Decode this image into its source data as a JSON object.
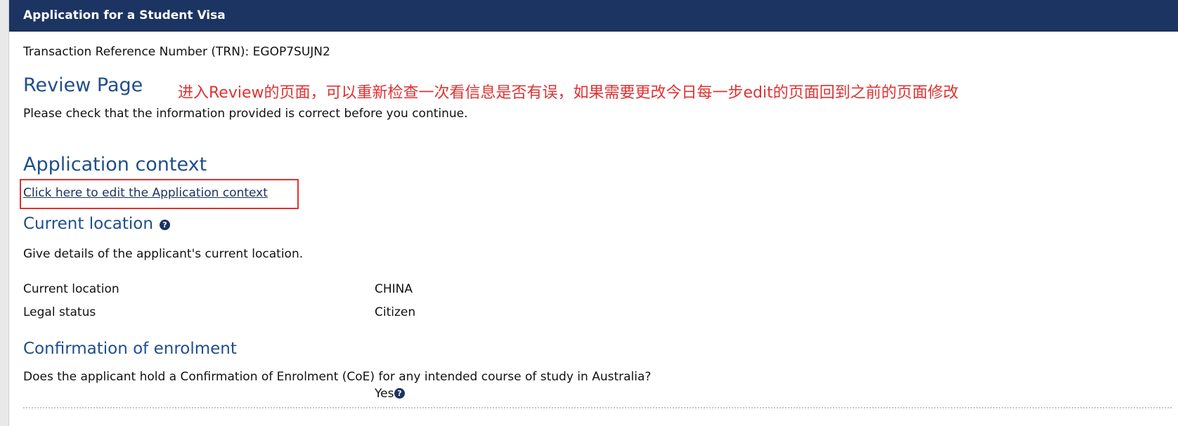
{
  "header": {
    "title": "Application for a Student Visa"
  },
  "trn": "Transaction Reference Number (TRN): EGOP7SUJN2",
  "review": {
    "title": "Review Page",
    "annotation": "进入Review的页面，可以重新检查一次看信息是否有误，如果需要更改今日每一步edit的页面回到之前的页面修改",
    "description": "Please check that the information provided is correct before you continue."
  },
  "application_context": {
    "title": "Application context",
    "edit_link": "Click here to edit the Application context"
  },
  "current_location": {
    "title": "Current location",
    "help_icon": "?",
    "description": "Give details of the applicant's current location.",
    "rows": [
      {
        "label": "Current location",
        "value": "CHINA"
      },
      {
        "label": "Legal status",
        "value": "Citizen"
      }
    ]
  },
  "enrolment": {
    "title": "Confirmation of enrolment",
    "question": "Does the applicant hold a Confirmation of Enrolment (CoE) for any intended course of study in Australia?",
    "answer": "Yes",
    "help_icon": "?"
  },
  "colors": {
    "header_bg": "#1c3461",
    "heading": "#1f4e8c",
    "annotation": "#e03131"
  }
}
